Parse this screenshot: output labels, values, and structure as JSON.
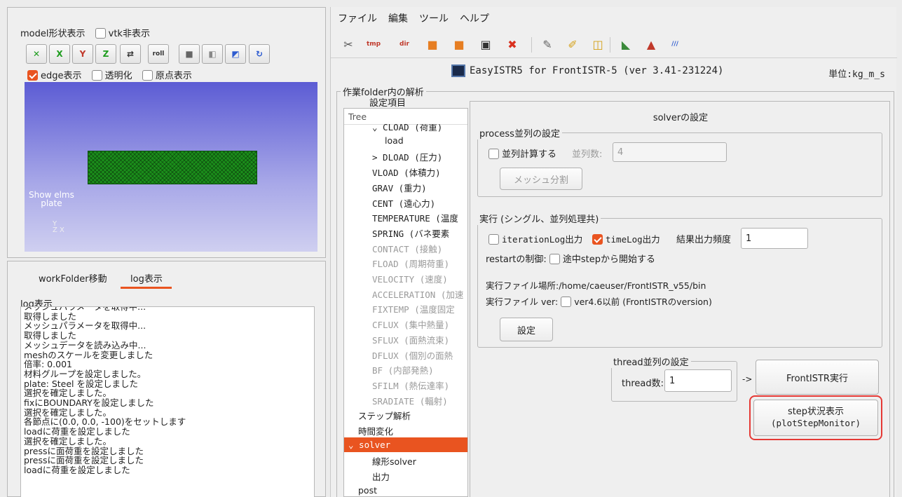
{
  "left_top": {
    "model_display_label": "model形状表示",
    "vtk_hide_label": "vtk非表示",
    "view_buttons": [
      {
        "name": "fit-view-icon",
        "glyph": "✕"
      },
      {
        "name": "view-x-icon",
        "glyph": "X"
      },
      {
        "name": "view-y-icon",
        "glyph": "Y"
      },
      {
        "name": "view-z-icon",
        "glyph": "Z"
      },
      {
        "name": "flip-icon",
        "glyph": "⇄"
      },
      {
        "name": "roll-icon",
        "glyph": "roll"
      },
      {
        "name": "solid-cube-icon",
        "glyph": "■"
      },
      {
        "name": "wire-cube-icon",
        "glyph": "◧"
      },
      {
        "name": "screenshot-icon",
        "glyph": "◩"
      },
      {
        "name": "reload-icon",
        "glyph": "↻"
      }
    ],
    "edge_label": "edge表示",
    "transparent_label": "透明化",
    "origin_label": "原点表示",
    "viewport_text_line1": "Show elms",
    "viewport_text_line2": "plate",
    "axis_label": "Y\nZ X"
  },
  "left_bottom": {
    "tabs": [
      "workFolder移動",
      "log表示"
    ],
    "log_title": "log表示",
    "log_lines": [
      "メッシュパラメータを取得中...",
      "取得しました",
      "メッシュパラメータを取得中...",
      "取得しました",
      "メッシュデータを読み込み中...",
      "meshのスケールを変更しました",
      "  倍率: 0.001",
      "材料グループを設定しました。",
      "plate: Steel を設定しました",
      "選択を確定しました。",
      "fixにBOUNDARYを設定しました",
      "選択を確定しました。",
      "各節点に(0.0, 0.0, -100)をセットします",
      "loadに荷重を設定しました",
      "選択を確定しました。",
      "pressに面荷重を設定しました",
      "pressに面荷重を設定しました",
      "loadに荷重を設定しました"
    ]
  },
  "menu": [
    "ファイル",
    "編集",
    "ツール",
    "ヘルプ"
  ],
  "toolbar": [
    {
      "name": "scissors-icon",
      "glyph": "✂",
      "color": "#555555"
    },
    {
      "name": "tmp-icon",
      "glyph": "tmp",
      "color": "#c0392b"
    },
    {
      "name": "dir-icon",
      "glyph": "dir",
      "color": "#c0392b"
    },
    {
      "name": "folder-icon",
      "glyph": "■",
      "color": "#e67e22"
    },
    {
      "name": "folder-open-icon",
      "glyph": "■",
      "color": "#e67e22"
    },
    {
      "name": "terminal-icon",
      "glyph": "▣",
      "color": "#333333"
    },
    {
      "name": "stop-icon",
      "glyph": "✖",
      "color": "#d9301e"
    },
    {
      "name": "edit-icon",
      "glyph": "✎",
      "color": "#666666"
    },
    {
      "name": "brush-icon",
      "glyph": "✐",
      "color": "#d4a017"
    },
    {
      "name": "new-file-icon",
      "glyph": "◫",
      "color": "#d4a017"
    },
    {
      "name": "paraview-icon",
      "glyph": "◣",
      "color": "#3b8a3b"
    },
    {
      "name": "salome-icon",
      "glyph": "▲",
      "color": "#c0392b"
    },
    {
      "name": "color-bar-icon",
      "glyph": "///",
      "color": "#2d5bd0"
    }
  ],
  "app_title": "EasyISTR5 for FrontISTR-5 (ver 3.41-231224)",
  "unit_label": "単位:kg_m_s",
  "work_folder_label": "作業folder内の解析",
  "settings_item_label": "設定項目",
  "tree": {
    "header": "Tree",
    "items": [
      {
        "label": "⌄ CLOAD (荷重)",
        "indent": 1,
        "dim": false
      },
      {
        "label": "load",
        "indent": 2,
        "dim": false
      },
      {
        "label": "> DLOAD (圧力)",
        "indent": 1,
        "dim": false
      },
      {
        "label": "VLOAD (体積力)",
        "indent": 1,
        "dim": false
      },
      {
        "label": "GRAV (重力)",
        "indent": 1,
        "dim": false
      },
      {
        "label": "CENT (遠心力)",
        "indent": 1,
        "dim": false
      },
      {
        "label": "TEMPERATURE (温度",
        "indent": 1,
        "dim": false
      },
      {
        "label": "SPRING (バネ要素",
        "indent": 1,
        "dim": false
      },
      {
        "label": "CONTACT (接触)",
        "indent": 1,
        "dim": true
      },
      {
        "label": "FLOAD (周期荷重)",
        "indent": 1,
        "dim": true
      },
      {
        "label": "VELOCITY (速度)",
        "indent": 1,
        "dim": true
      },
      {
        "label": "ACCELERATION (加速",
        "indent": 1,
        "dim": true
      },
      {
        "label": "FIXTEMP (温度固定",
        "indent": 1,
        "dim": true
      },
      {
        "label": "CFLUX (集中熱量)",
        "indent": 1,
        "dim": true
      },
      {
        "label": "SFLUX (面熱流束)",
        "indent": 1,
        "dim": true
      },
      {
        "label": "DFLUX (個別の面熱",
        "indent": 1,
        "dim": true
      },
      {
        "label": "BF (内部発熱)",
        "indent": 1,
        "dim": true
      },
      {
        "label": "SFILM (熱伝達率)",
        "indent": 1,
        "dim": true
      },
      {
        "label": "SRADIATE (輻射)",
        "indent": 1,
        "dim": true
      },
      {
        "label": "ステップ解析",
        "indent": 0,
        "dim": false
      },
      {
        "label": "時間変化",
        "indent": 0,
        "dim": false
      },
      {
        "label": "⌄ solver",
        "indent": -1,
        "dim": false,
        "selected": true
      },
      {
        "label": "線形solver",
        "indent": 1,
        "dim": false
      },
      {
        "label": "出力",
        "indent": 1,
        "dim": false
      },
      {
        "label": "post",
        "indent": 0,
        "dim": false
      }
    ]
  },
  "solver": {
    "title": "solverの設定",
    "process_group": "process並列の設定",
    "parallel_calc_label": "並列計算する",
    "parallel_num_label": "並列数:",
    "parallel_num_value": "4",
    "mesh_split_button": "メッシュ分割",
    "exec_group": "実行 (シングル、並列処理共)",
    "iteration_log_label": "iterationLog出力",
    "time_log_label": "timeLog出力",
    "result_freq_label": "結果出力頻度",
    "result_freq_value": "1",
    "restart_label": "restartの制御:",
    "restart_option_label": "途中stepから開始する",
    "exec_path_label": "実行ファイル場所:/home/caeuser/FrontISTR_v55/bin",
    "exec_ver_label": "実行ファイル ver:",
    "exec_ver_option": "ver4.6以前 (FrontISTRのversion)",
    "settings_button": "設定",
    "thread_group": "thread並列の設定",
    "thread_num_label": "thread数:",
    "thread_num_value": "1",
    "arrow_label": "->",
    "run_button": "FrontISTR実行",
    "step_monitor_line1": "step状況表示",
    "step_monitor_line2": "(plotStepMonitor)"
  },
  "colors": {
    "accent": "#e95420",
    "viewport_top": "#5f5fd6",
    "viewport_bottom": "#c8c8ee",
    "mesh_green": "#1e9c1e",
    "highlight_red": "#e53935"
  }
}
